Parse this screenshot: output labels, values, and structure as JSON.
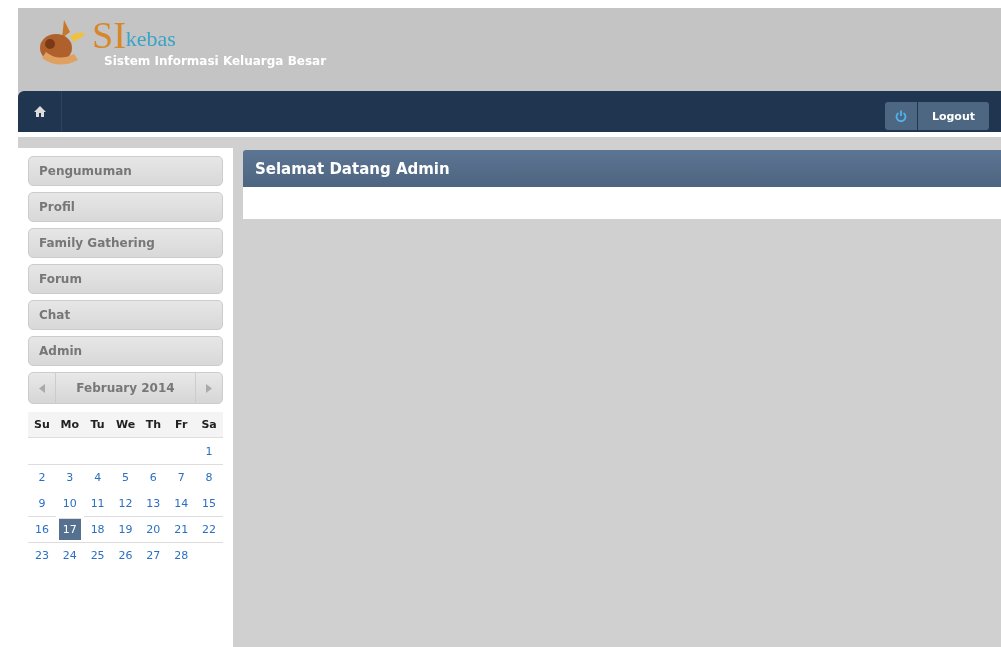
{
  "header": {
    "logo_initials": "SI",
    "logo_name": "kebas",
    "subtitle": "Sistem Informasi Keluarga Besar"
  },
  "navbar": {
    "logout_label": "Logout"
  },
  "menu": [
    {
      "label": "Pengumuman"
    },
    {
      "label": "Profil"
    },
    {
      "label": "Family Gathering"
    },
    {
      "label": "Forum"
    },
    {
      "label": "Chat"
    },
    {
      "label": "Admin"
    }
  ],
  "calendar": {
    "month": "February 2014",
    "weekdays": [
      "Su",
      "Mo",
      "Tu",
      "We",
      "Th",
      "Fr",
      "Sa"
    ],
    "weeks": [
      [
        {
          "day": "1",
          "selected": false
        }
      ],
      [
        {
          "day": "2",
          "selected": false
        },
        {
          "day": "3",
          "selected": false
        },
        {
          "day": "4",
          "selected": false
        },
        {
          "day": "5",
          "selected": false
        },
        {
          "day": "6",
          "selected": false
        },
        {
          "day": "7",
          "selected": false
        },
        {
          "day": "8",
          "selected": false
        }
      ],
      [
        {
          "day": "9",
          "selected": false
        },
        {
          "day": "10",
          "selected": false
        },
        {
          "day": "11",
          "selected": false
        },
        {
          "day": "12",
          "selected": false
        },
        {
          "day": "13",
          "selected": false
        },
        {
          "day": "14",
          "selected": false
        },
        {
          "day": "15",
          "selected": false
        }
      ],
      [
        {
          "day": "16",
          "selected": false
        },
        {
          "day": "17",
          "selected": true
        },
        {
          "day": "18",
          "selected": false
        },
        {
          "day": "19",
          "selected": false
        },
        {
          "day": "20",
          "selected": false
        },
        {
          "day": "21",
          "selected": false
        },
        {
          "day": "22",
          "selected": false
        }
      ],
      [
        {
          "day": "23",
          "selected": false
        },
        {
          "day": "24",
          "selected": false
        },
        {
          "day": "25",
          "selected": false
        },
        {
          "day": "26",
          "selected": false
        },
        {
          "day": "27",
          "selected": false
        },
        {
          "day": "28",
          "selected": false
        }
      ]
    ]
  },
  "content": {
    "title": "Selamat Datang Admin"
  }
}
